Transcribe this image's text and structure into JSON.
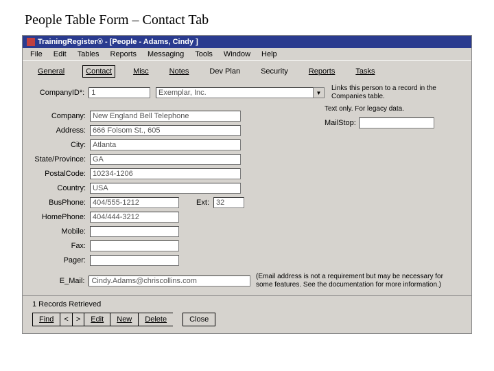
{
  "doc_heading": "People Table Form – Contact Tab",
  "titlebar": "TrainingRegister® - [People - Adams, Cindy ]",
  "menu": [
    "File",
    "Edit",
    "Tables",
    "Reports",
    "Messaging",
    "Tools",
    "Window",
    "Help"
  ],
  "tabs": {
    "general": "General",
    "contact": "Contact",
    "misc": "Misc",
    "notes": "Notes",
    "devplan": "Dev Plan",
    "security": "Security",
    "reports": "Reports",
    "tasks": "Tasks"
  },
  "labels": {
    "companyid": "CompanyID*:",
    "company": "Company:",
    "address": "Address:",
    "city": "City:",
    "stateprov": "State/Province:",
    "postal": "PostalCode:",
    "country": "Country:",
    "busphone": "BusPhone:",
    "ext": "Ext:",
    "homephone": "HomePhone:",
    "mobile": "Mobile:",
    "fax": "Fax:",
    "pager": "Pager:",
    "email": "E_Mail:"
  },
  "values": {
    "companyid": "1",
    "company_combo": "Exemplar, Inc.",
    "company": "New England Bell Telephone",
    "address": "666 Folsom St., 605",
    "city": "Atlanta",
    "stateprov": "GA",
    "postal": "10234-1206",
    "country": "USA",
    "busphone": "404/555-1212",
    "ext": "32",
    "homephone": "404/444-3212",
    "mobile": "",
    "fax": "",
    "pager": "",
    "email": "Cindy.Adams@chriscollins.com",
    "mailstop": ""
  },
  "notes": {
    "companyid": "Links this person to a record in the Companies table.",
    "legacy": "Text only.  For legacy data.",
    "mailstop_label": "MailStop:",
    "email": "(Email address is not a requirement but may be necessary for some features.  See the documentation for more information.)"
  },
  "footer": {
    "records": "1 Records Retrieved",
    "find": "Find",
    "prev": "<",
    "next": ">",
    "edit": "Edit",
    "new": "New",
    "delete": "Delete",
    "close": "Close"
  }
}
